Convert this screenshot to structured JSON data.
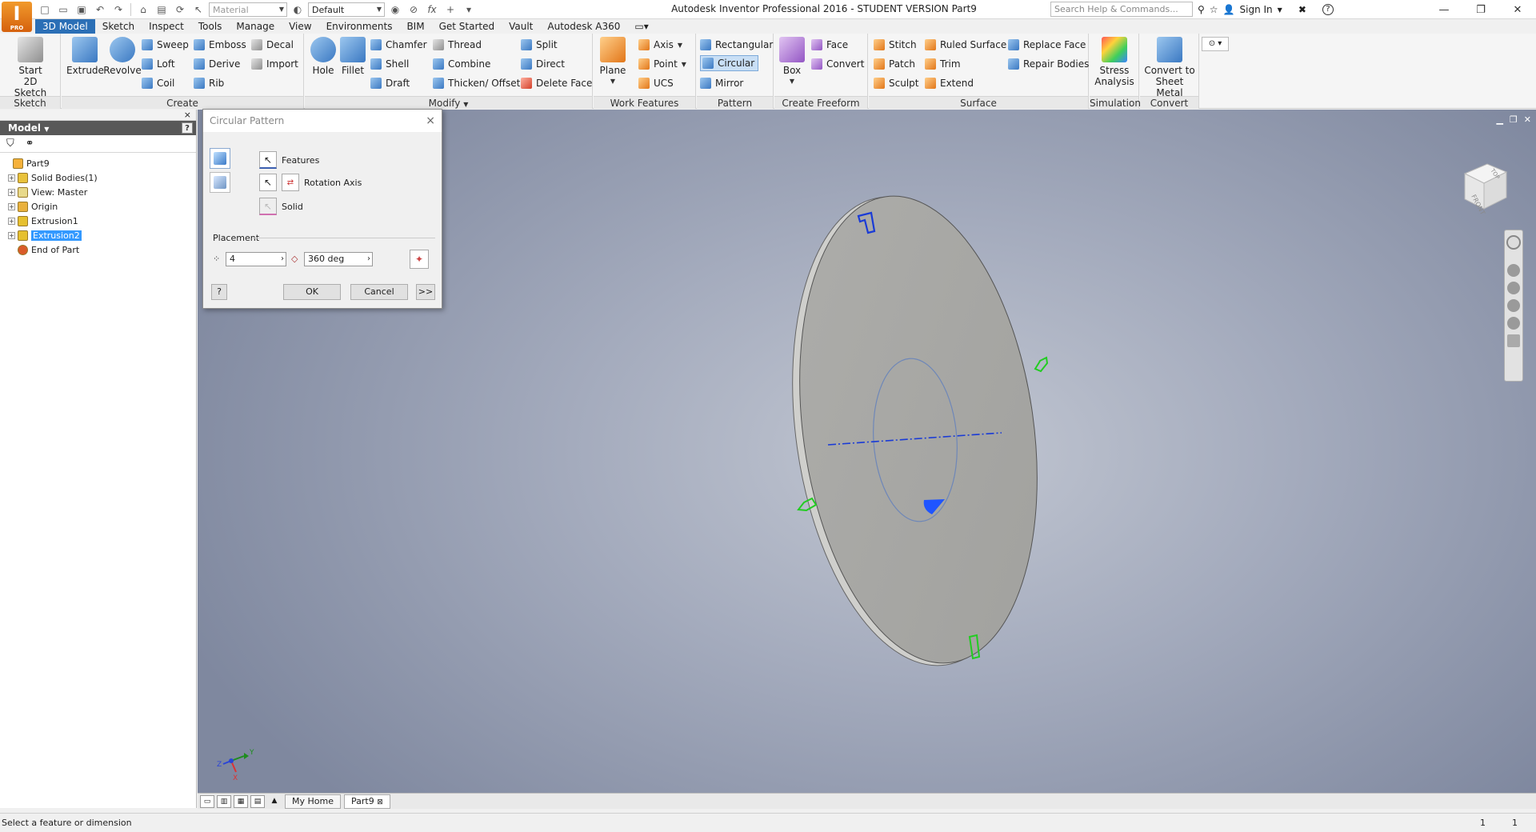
{
  "window": {
    "title": "Autodesk Inventor Professional 2016 - STUDENT VERSION   Part9",
    "logo_text": "I",
    "logo_badge": "PRO",
    "search_placeholder": "Search Help & Commands...",
    "sign_in": "Sign In"
  },
  "quick_access": {
    "material_combo": "Material",
    "appearance_combo": "Default",
    "fx": "fx"
  },
  "ribbon_tabs": [
    "3D Model",
    "Sketch",
    "Inspect",
    "Tools",
    "Manage",
    "View",
    "Environments",
    "BIM",
    "Get Started",
    "Vault",
    "Autodesk A360"
  ],
  "ribbon": {
    "sketch": {
      "label": "Sketch",
      "start_line1": "Start",
      "start_line2": "2D Sketch"
    },
    "create": {
      "label": "Create",
      "extrude": "Extrude",
      "revolve": "Revolve",
      "sweep": "Sweep",
      "emboss": "Emboss",
      "decal": "Decal",
      "loft": "Loft",
      "derive": "Derive",
      "import": "Import",
      "coil": "Coil",
      "rib": "Rib"
    },
    "modify": {
      "label": "Modify",
      "hole": "Hole",
      "fillet": "Fillet",
      "chamfer": "Chamfer",
      "thread": "Thread",
      "split": "Split",
      "shell": "Shell",
      "combine": "Combine",
      "direct": "Direct",
      "draft": "Draft",
      "thicken": "Thicken/ Offset",
      "delete_face": "Delete Face"
    },
    "work_features": {
      "label": "Work Features",
      "plane": "Plane",
      "axis": "Axis",
      "point": "Point",
      "ucs": "UCS"
    },
    "pattern": {
      "label": "Pattern",
      "rectangular": "Rectangular",
      "circular": "Circular",
      "mirror": "Mirror"
    },
    "freeform": {
      "label": "Create Freeform",
      "box": "Box",
      "face": "Face",
      "convert": "Convert"
    },
    "surface": {
      "label": "Surface",
      "stitch": "Stitch",
      "ruled_surface": "Ruled Surface",
      "replace_face": "Replace Face",
      "patch": "Patch",
      "trim": "Trim",
      "repair_bodies": "Repair Bodies",
      "sculpt": "Sculpt",
      "extend": "Extend"
    },
    "simulation": {
      "label": "Simulation",
      "stress_line1": "Stress",
      "stress_line2": "Analysis"
    },
    "convert": {
      "label": "Convert",
      "sheet_line1": "Convert to",
      "sheet_line2": "Sheet Metal"
    }
  },
  "browser": {
    "title": "Model",
    "help": "?",
    "close": "×",
    "tree": [
      {
        "label": "Part9",
        "level": 0,
        "expander": "",
        "selected": false
      },
      {
        "label": "Solid Bodies(1)",
        "level": 1,
        "expander": "+",
        "selected": false
      },
      {
        "label": "View: Master",
        "level": 1,
        "expander": "+",
        "selected": false
      },
      {
        "label": "Origin",
        "level": 1,
        "expander": "+",
        "selected": false
      },
      {
        "label": "Extrusion1",
        "level": 1,
        "expander": "+",
        "selected": false
      },
      {
        "label": "Extrusion2",
        "level": 1,
        "expander": "+",
        "selected": true
      },
      {
        "label": "End of Part",
        "level": 1,
        "expander": "",
        "selected": false
      }
    ]
  },
  "dialog": {
    "title": "Circular Pattern",
    "close": "×",
    "features_label": "Features",
    "rotation_axis_label": "Rotation Axis",
    "solid_label": "Solid",
    "placement_label": "Placement",
    "count_value": "4",
    "angle_value": "360 deg",
    "help": "?",
    "ok": "OK",
    "cancel": "Cancel",
    "more": ">>"
  },
  "viewcube": {
    "front": "FRONT",
    "top": "TOP"
  },
  "axis_triad": {
    "x": "X",
    "y": "Y",
    "z": "Z"
  },
  "doc_tabs": {
    "home": "My Home",
    "part": "Part9",
    "part_close": "⊠"
  },
  "status": {
    "text": "Select a feature or dimension",
    "n1": "1",
    "n2": "1"
  },
  "colors": {
    "accent": "#2b6fb6",
    "model_face": "#a7a7a3",
    "feature_green": "#22cc22",
    "axis_blue": "#1a3bd6"
  }
}
